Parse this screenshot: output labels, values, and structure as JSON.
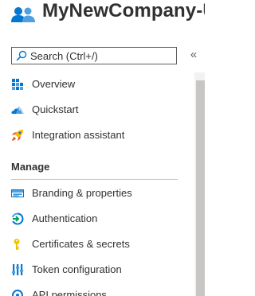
{
  "header": {
    "title": "MyNewCompany-U"
  },
  "search": {
    "placeholder": "Search (Ctrl+/)"
  },
  "collapse": {
    "glyph": "«"
  },
  "nav": {
    "items": [
      {
        "label": "Overview",
        "icon": "overview-grid-icon"
      },
      {
        "label": "Quickstart",
        "icon": "quickstart-cloud-icon"
      },
      {
        "label": "Integration assistant",
        "icon": "integration-rocket-icon"
      }
    ],
    "section": "Manage",
    "manage_items": [
      {
        "label": "Branding & properties",
        "icon": "branding-icon"
      },
      {
        "label": "Authentication",
        "icon": "authentication-icon"
      },
      {
        "label": "Certificates & secrets",
        "icon": "key-icon"
      },
      {
        "label": "Token configuration",
        "icon": "token-bars-icon"
      },
      {
        "label": "API permissions",
        "icon": "api-permissions-icon"
      }
    ]
  },
  "colors": {
    "accent": "#0078d4",
    "text": "#323130",
    "key": "#f0c300",
    "rocket": "#e8622a"
  }
}
